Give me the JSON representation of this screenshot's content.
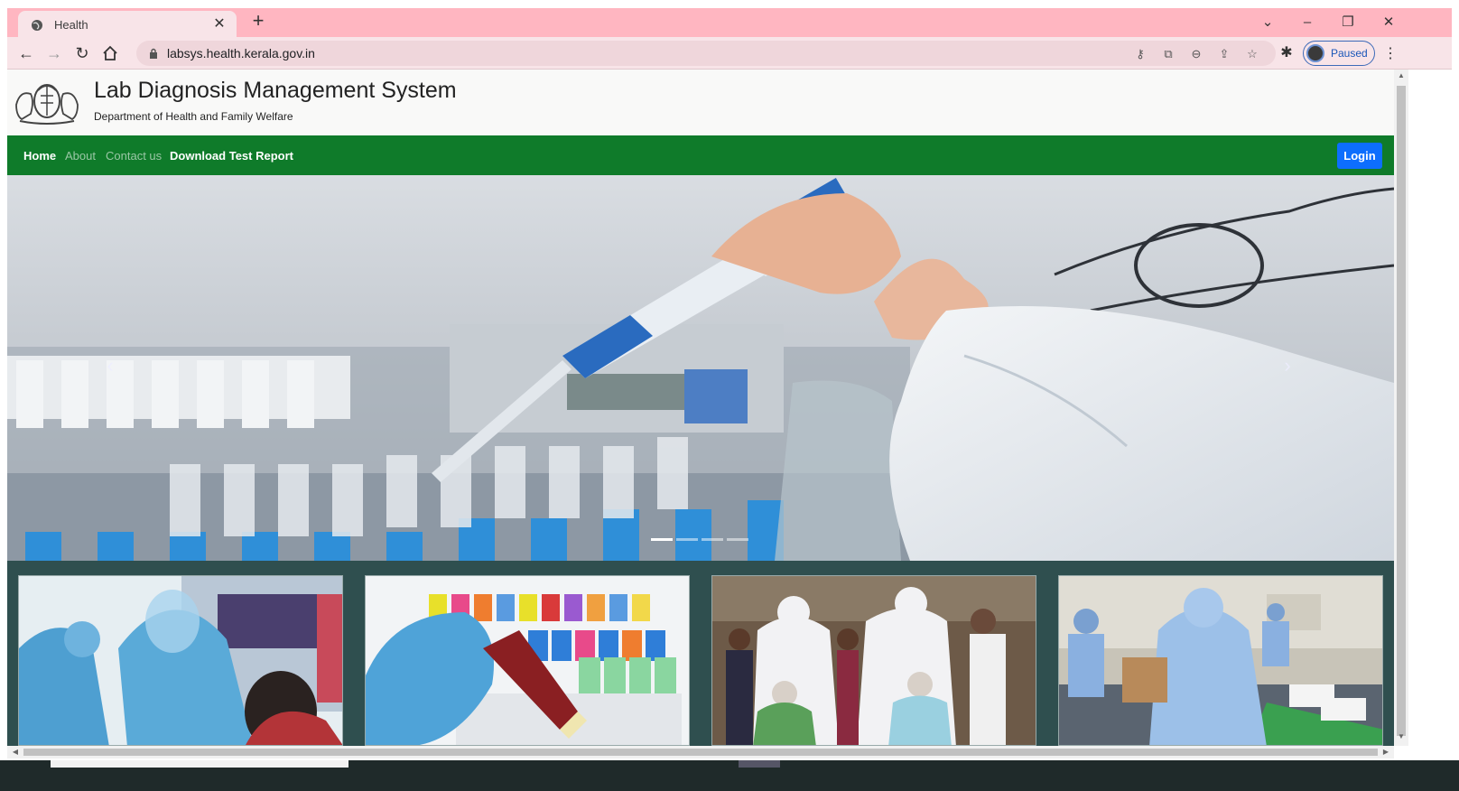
{
  "browser": {
    "tab_title": "Health",
    "url": "labsys.health.kerala.gov.in",
    "profile_status": "Paused",
    "new_tab_symbol": "+",
    "close_symbol": "✕"
  },
  "site": {
    "title": "Lab Diagnosis Management System",
    "subtitle": "Department of Health and Family Welfare"
  },
  "nav": {
    "items": [
      {
        "label": "Home",
        "active": true
      },
      {
        "label": "About",
        "active": false
      },
      {
        "label": "Contact us",
        "active": false
      },
      {
        "label": "Download Test Report",
        "active": true
      }
    ],
    "login_label": "Login"
  },
  "carousel": {
    "slide_count": 4,
    "active_index": 0,
    "prev_symbol": "‹",
    "next_symbol": "›"
  },
  "cards": [
    {
      "icon": "covid-swab-test-photo"
    },
    {
      "icon": "blood-sample-tubes-photo"
    },
    {
      "icon": "health-workers-ppe-photo"
    },
    {
      "icon": "lab-worker-packaging-photo"
    }
  ],
  "colors": {
    "tab_strip": "#ffb6c1",
    "navbar": "#0f7b2a",
    "login_button": "#0d6efd",
    "page_background": "#2f4f4f"
  }
}
